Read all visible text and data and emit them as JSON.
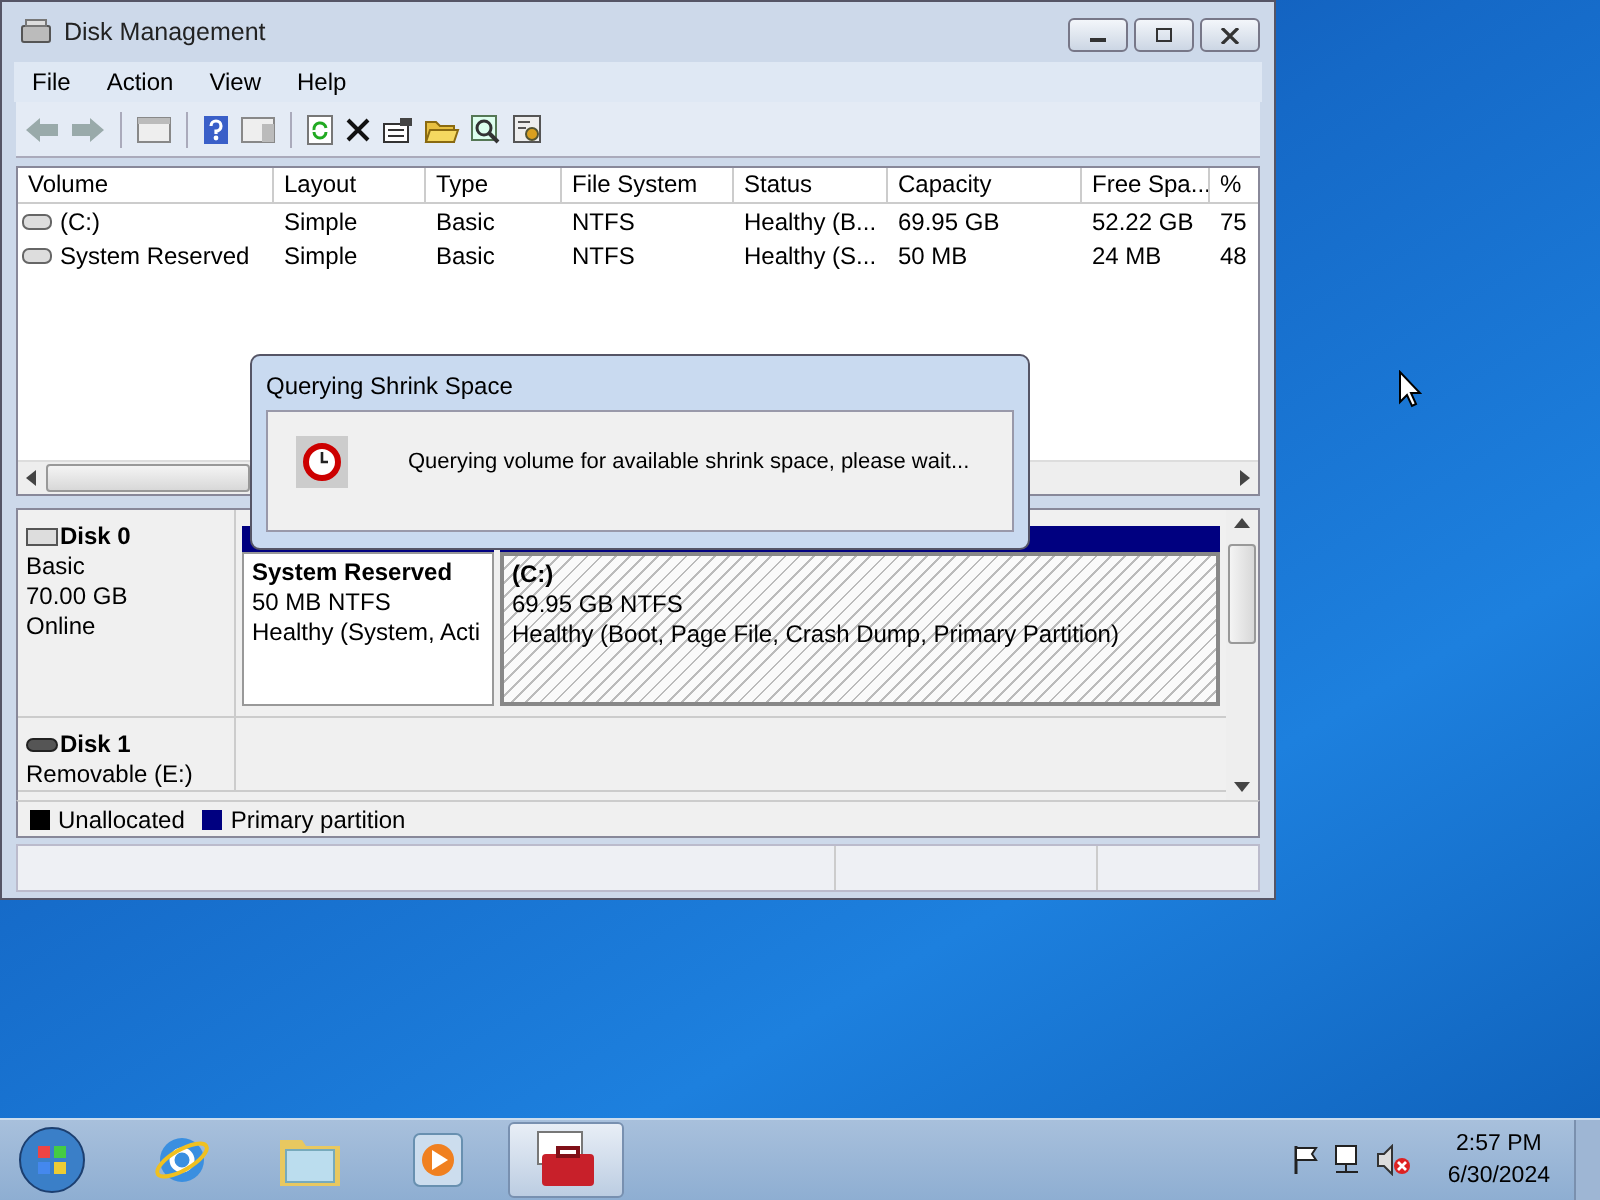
{
  "window": {
    "title": "Disk Management"
  },
  "menu": [
    "File",
    "Action",
    "View",
    "Help"
  ],
  "table": {
    "columns": [
      "Volume",
      "Layout",
      "Type",
      "File System",
      "Status",
      "Capacity",
      "Free Spa...",
      "%"
    ],
    "rows": [
      {
        "cells": [
          "(C:)",
          "Simple",
          "Basic",
          "NTFS",
          "Healthy (B...",
          "69.95 GB",
          "52.22 GB",
          "75"
        ]
      },
      {
        "cells": [
          "System Reserved",
          "Simple",
          "Basic",
          "NTFS",
          "Healthy (S...",
          "50 MB",
          "24 MB",
          "48"
        ]
      }
    ]
  },
  "disks": [
    {
      "name": "Disk 0",
      "kind": "fixed",
      "lines": [
        "Basic",
        "70.00 GB",
        "Online"
      ],
      "partitions": [
        {
          "name": "System Reserved",
          "size": "50 MB NTFS",
          "status": "Healthy (System, Acti",
          "selected": false
        },
        {
          "name": "(C:)",
          "size": "69.95 GB NTFS",
          "status": "Healthy (Boot, Page File, Crash Dump, Primary Partition)",
          "selected": true
        }
      ]
    },
    {
      "name": "Disk 1",
      "kind": "removable",
      "lines": [
        "Removable (E:)"
      ]
    }
  ],
  "legend": [
    {
      "label": "Unallocated",
      "color": "#000000"
    },
    {
      "label": "Primary partition",
      "color": "#000080"
    }
  ],
  "dialog": {
    "title": "Querying Shrink Space",
    "message": "Querying volume for available shrink space, please wait..."
  },
  "taskbar": {
    "items": [
      {
        "kind": "browser",
        "selected": false
      },
      {
        "kind": "folder",
        "selected": false
      },
      {
        "kind": "media",
        "selected": false
      },
      {
        "kind": "toolbox",
        "selected": true
      }
    ],
    "time": "2:57 PM",
    "date": "6/30/2024"
  }
}
